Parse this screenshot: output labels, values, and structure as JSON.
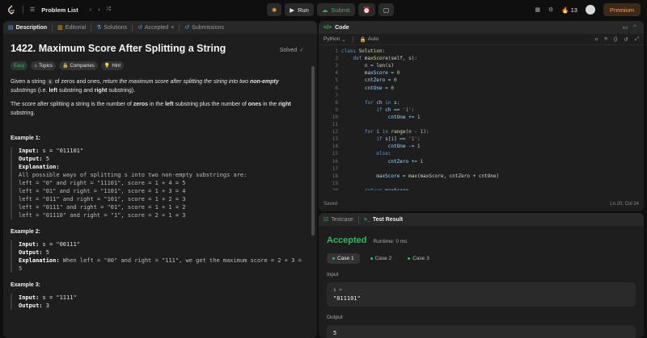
{
  "topbar": {
    "problem_list": "Problem List",
    "run": "Run",
    "submit": "Submit",
    "streak": "13",
    "premium": "Premium"
  },
  "left_tabs": [
    "Description",
    "Editorial",
    "Solutions",
    "Accepted",
    "Submissions"
  ],
  "problem": {
    "title": "1422. Maximum Score After Splitting a String",
    "status": "Solved",
    "difficulty": "Easy",
    "chips": [
      "Topics",
      "Companies",
      "Hint"
    ],
    "p1_pre": "Given a string ",
    "p1_code": "s",
    "p1_mid": " of zeros and ones, ",
    "p1_em": "return the maximum score after splitting the string into two ",
    "p1_strong": "non-empty",
    "p1_em2": " substrings",
    "p1_post": " (i.e. ",
    "p1_left": "left",
    "p1_and": " substring and ",
    "p1_right": "right",
    "p1_end": " substring).",
    "p2_pre": "The score after splitting a string is the number of ",
    "p2_zeros": "zeros",
    "p2_in": " in the ",
    "p2_left": "left",
    "p2_mid": " substring plus the number of ",
    "p2_ones": "ones",
    "p2_in2": " in the ",
    "p2_right": "right",
    "p2_end": " substring.",
    "examples": [
      {
        "title": "Example 1:",
        "input": "s = \"011101\"",
        "output": "5",
        "explanation_inline": "",
        "lines": [
          "All possible ways of splitting s into two non-empty substrings are:",
          "left = \"0\" and right = \"11101\", score = 1 + 4 = 5",
          "left = \"01\" and right = \"1101\", score = 1 + 3 = 4",
          "left = \"011\" and right = \"101\", score = 1 + 2 = 3",
          "left = \"0111\" and right = \"01\", score = 1 + 1 = 2",
          "left = \"01110\" and right = \"1\", score = 2 + 1 = 3"
        ]
      },
      {
        "title": "Example 2:",
        "input": "s = \"00111\"",
        "output": "5",
        "explanation_inline": "When left = \"00\" and right = \"111\", we get the maximum score = 2 + 3 =",
        "lines": [
          "5"
        ]
      },
      {
        "title": "Example 3:",
        "input": "s = \"1111\"",
        "output": "3",
        "explanation_inline": "",
        "lines": []
      }
    ],
    "labels": {
      "input": "Input:",
      "output": "Output:",
      "explanation": "Explanation:"
    }
  },
  "code": {
    "tab": "Code",
    "language": "Python",
    "mode": "Auto",
    "status_left": "Saved",
    "status_right": "Ln 20, Col 24",
    "lines": [
      {
        "n": "1",
        "html": "<span class='kw'>class</span> <span class='fn'>Solution</span><span class='pl'>:</span>"
      },
      {
        "n": "2",
        "html": "    <span class='kw'>def</span> <span class='fn'>maxScore</span><span class='pl'>(self, s):</span>"
      },
      {
        "n": "3",
        "html": "        n = <span class='fn'>len</span><span class='pl'>(s)</span>"
      },
      {
        "n": "4",
        "html": "        maxScore = <span class='num'>0</span>"
      },
      {
        "n": "5",
        "html": "        cntZero = <span class='num'>0</span>"
      },
      {
        "n": "6",
        "html": "        cntOne = <span class='num'>0</span>"
      },
      {
        "n": "7",
        "html": ""
      },
      {
        "n": "8",
        "html": "        <span class='kw'>for</span> ch <span class='kw'>in</span> s<span class='pl'>:</span>"
      },
      {
        "n": "9",
        "html": "            <span class='kw'>if</span> ch == <span class='str'>'1'</span><span class='pl'>:</span>"
      },
      {
        "n": "10",
        "html": "                cntOne += <span class='num'>1</span>"
      },
      {
        "n": "11",
        "html": ""
      },
      {
        "n": "12",
        "html": "        <span class='kw'>for</span> i <span class='kw'>in</span> <span class='fn'>range</span><span class='pl'>(n - </span><span class='num'>1</span><span class='pl'>):</span>"
      },
      {
        "n": "13",
        "html": "            <span class='kw'>if</span> s[i] == <span class='str'>'1'</span><span class='pl'>:</span>"
      },
      {
        "n": "14",
        "html": "                cntOne -= <span class='num'>1</span>"
      },
      {
        "n": "15",
        "html": "            <span class='kw'>else</span><span class='pl'>:</span>"
      },
      {
        "n": "16",
        "html": "                cntZero += <span class='num'>1</span>"
      },
      {
        "n": "17",
        "html": ""
      },
      {
        "n": "18",
        "html": "            maxScore = <span class='fn'>max</span><span class='pl'>(maxScore, cntZero + cntOne)</span>"
      },
      {
        "n": "19",
        "html": ""
      },
      {
        "n": "20",
        "html": "        <span class='kw'>return</span> maxScore"
      }
    ]
  },
  "result": {
    "tabs": [
      "Testcase",
      "Test Result"
    ],
    "verdict": "Accepted",
    "runtime": "Runtime: 0 ms",
    "cases": [
      "Case 1",
      "Case 2",
      "Case 3"
    ],
    "input_label": "Input",
    "input_var": "s =",
    "input_value": "\"011101\"",
    "output_label": "Output",
    "output_value": "5"
  },
  "colors": {
    "accent": "#ffa116",
    "success": "#2cbb5d",
    "panel": "#1e1e1e"
  },
  "icons": [
    "leetcode-logo-icon",
    "list-icon",
    "chevron-left-icon",
    "chevron-right-icon",
    "shuffle-icon",
    "bug-icon",
    "play-icon",
    "cloud-upload-icon",
    "alarm-icon",
    "note-icon",
    "grid-icon",
    "gear-icon",
    "fire-icon"
  ]
}
